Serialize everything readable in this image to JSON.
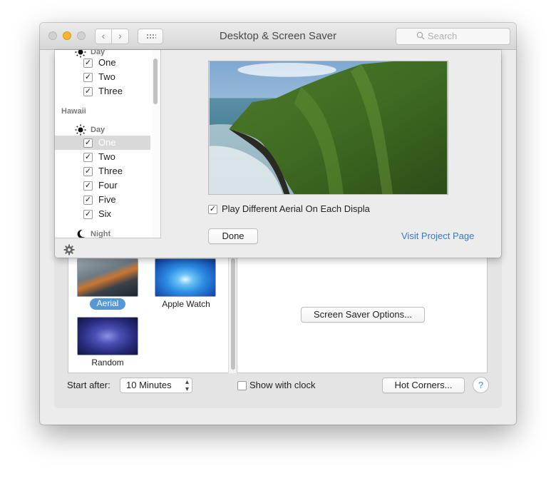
{
  "window": {
    "title": "Desktop & Screen Saver",
    "search_placeholder": "Search"
  },
  "sheet": {
    "tree": {
      "top_group": {
        "subheader": "Day",
        "items": [
          {
            "label": "One",
            "checked": true
          },
          {
            "label": "Two",
            "checked": true
          },
          {
            "label": "Three",
            "checked": true
          }
        ]
      },
      "hawaii": {
        "section_label": "Hawaii",
        "day_label": "Day",
        "items": [
          {
            "label": "One",
            "checked": true,
            "selected": true
          },
          {
            "label": "Two",
            "checked": true
          },
          {
            "label": "Three",
            "checked": true
          },
          {
            "label": "Four",
            "checked": true
          },
          {
            "label": "Five",
            "checked": true
          },
          {
            "label": "Six",
            "checked": true
          }
        ],
        "night_label": "Night"
      }
    },
    "play_different_label": "Play Different Aerial On Each Displa",
    "play_different_checked": true,
    "done_label": "Done",
    "visit_link": "Visit Project Page"
  },
  "screensavers": [
    {
      "label": "Aerial",
      "selected": true
    },
    {
      "label": "Apple Watch",
      "selected": false
    },
    {
      "label": "Random",
      "selected": false
    }
  ],
  "options_button": "Screen Saver Options...",
  "start_after": {
    "label": "Start after:",
    "value": "10 Minutes"
  },
  "show_with_clock": {
    "label": "Show with clock",
    "checked": false
  },
  "hot_corners_button": "Hot Corners...",
  "help_label": "?",
  "colors": {
    "accent": "#5797d6",
    "link": "#3a78c4",
    "minimize": "#f5b52c"
  }
}
